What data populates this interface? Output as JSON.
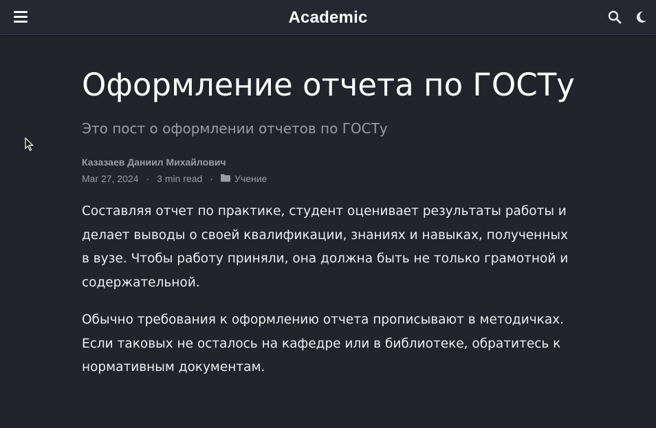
{
  "navbar": {
    "brand": "Academic",
    "menu_icon": "hamburger-menu-icon",
    "search_icon": "search-icon",
    "theme_icon": "moon-icon"
  },
  "article": {
    "title": "Оформление отчета по ГОСТу",
    "subtitle": "Это пост о оформлении отчетов по ГОСТу",
    "author": "Казазаев Даниил Михайлович",
    "date": "Mar 27, 2024",
    "separator": "·",
    "reading_time": "3 min read",
    "category_icon": "folder-icon",
    "category": "Учение",
    "paragraphs": [
      "Составляя отчет по практике, студент оценивает результаты работы и делает выводы о своей квалификации, знаниях и навыках, полученных в вузе. Чтобы работу приняли, она должна быть не только грамотной и содержательной.",
      "Обычно требования к оформлению отчета прописывают в методичках. Если таковых не осталось на кафедре или в библиотеке, обратитесь к нормативным документам."
    ]
  },
  "colors": {
    "background": "#22232b",
    "navbar": "#262731",
    "text": "#e9e9ec",
    "muted": "#9a9ba3"
  }
}
